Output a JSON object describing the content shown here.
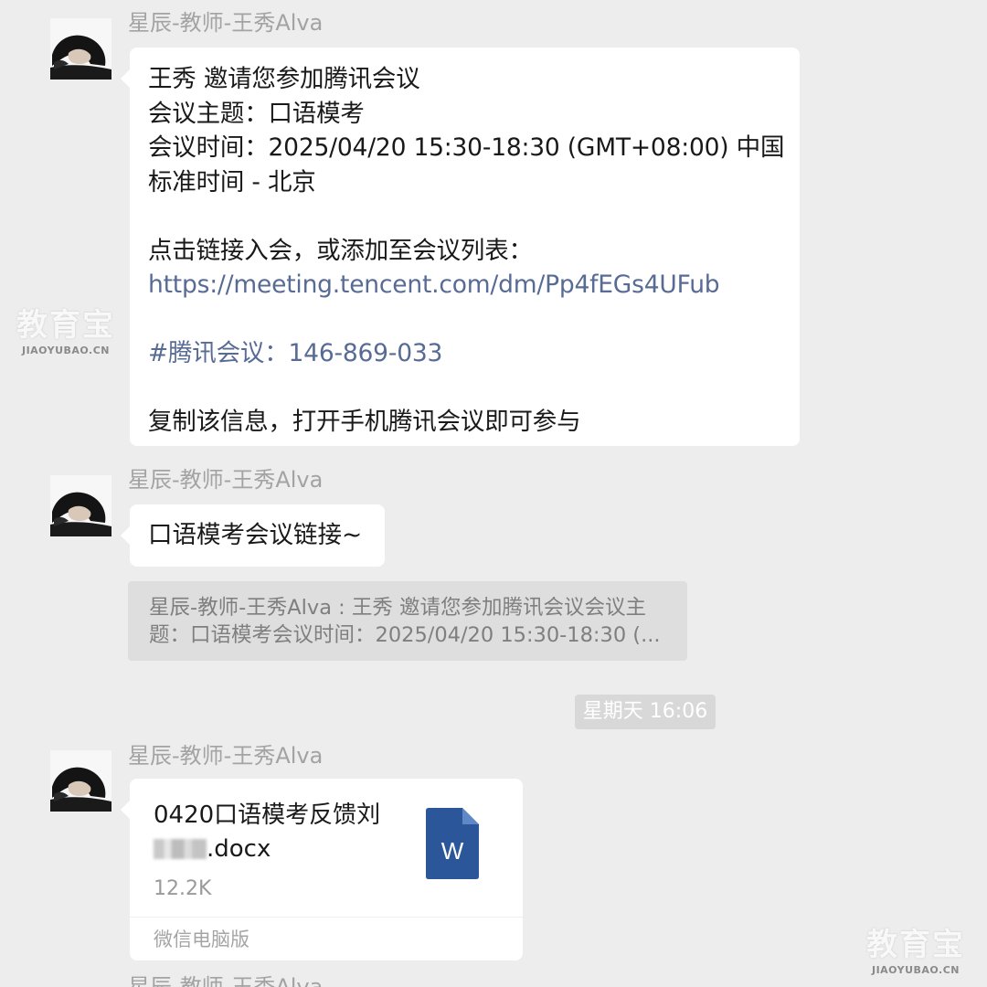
{
  "sender": "星辰-教师-王秀Alva",
  "message1": {
    "lines": [
      "王秀 邀请您参加腾讯会议",
      "会议主题：口语模考",
      "会议时间：2025/04/20 15:30-18:30 (GMT+08:00) 中国",
      "标准时间 - 北京",
      "",
      "点击链接入会，或添加至会议列表：",
      "https://meeting.tencent.com/dm/Pp4fEGs4UFub",
      "",
      "#腾讯会议：146-869-033",
      "",
      "复制该信息，打开手机腾讯会议即可参与"
    ]
  },
  "message2": {
    "text": "口语模考会议链接~",
    "quote_line1": "星辰-教师-王秀Alva : 王秀 邀请您参加腾讯会议会议主",
    "quote_line2": "题：口语模考会议时间：2025/04/20 15:30-18:30 (..."
  },
  "timestamp": "星期天 16:06",
  "file": {
    "name_line1": "0420口语模考反馈刘",
    "name_line2_suffix": ".docx",
    "size": "12.2K",
    "source": "微信电脑版",
    "icon": "word-doc-icon",
    "icon_letter": "W",
    "icon_color": "#2b579a"
  },
  "watermark": {
    "main": "教育宝",
    "sub": "JIAOYUBAO.CN"
  },
  "partial_sender": "星辰-教师-王秀Alva"
}
